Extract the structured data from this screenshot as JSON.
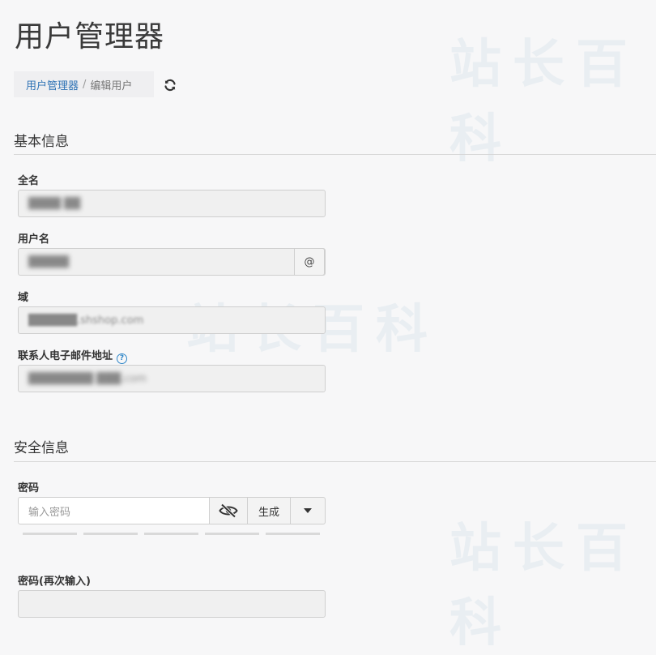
{
  "page": {
    "title": "用户管理器"
  },
  "breadcrumb": {
    "parent": "用户管理器",
    "separator": "/",
    "current": "编辑用户"
  },
  "sections": {
    "basic": "基本信息",
    "security": "安全信息"
  },
  "fields": {
    "full_name": {
      "label": "全名",
      "value": "████ ██"
    },
    "username": {
      "label": "用户名",
      "value": "█████",
      "addon": "@"
    },
    "domain": {
      "label": "域",
      "value": "██████.shshop.com"
    },
    "contact_email": {
      "label": "联系人电子邮件地址",
      "value": "████████ ███.com"
    },
    "password": {
      "label": "密码",
      "placeholder": "输入密码",
      "generate_label": "生成"
    },
    "password_confirm": {
      "label": "密码(再次输入)",
      "value": ""
    }
  },
  "icons": {
    "refresh": "refresh-icon",
    "help": "question-circle-icon",
    "eye": "eye-slash-icon",
    "dropdown": "caret-down-icon"
  },
  "colors": {
    "link": "#2f73b5",
    "help": "#2f86c8",
    "background": "#f7f7f8"
  }
}
